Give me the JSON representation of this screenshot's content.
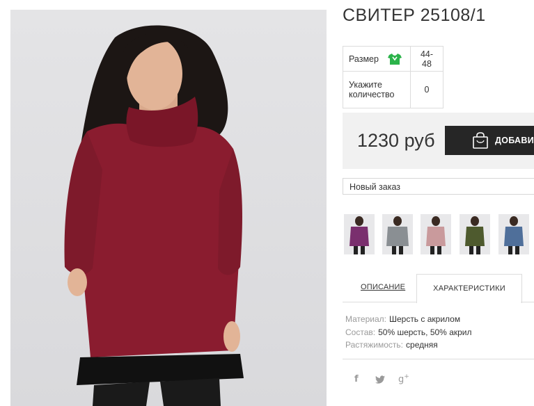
{
  "product": {
    "title": "СВИТЕР 25108/1",
    "options": {
      "size_label": "Размер",
      "size_value": "44-48",
      "qty_label": "Укажите количество",
      "qty_value": "0"
    },
    "price": "1230 руб",
    "add_button_label": "ДОБАВИТЬ",
    "order_select_value": "Новый заказ",
    "thumbnails": [
      {
        "color": "#7a2f6e"
      },
      {
        "color": "#8a8f93"
      },
      {
        "color": "#c99a9c"
      },
      {
        "color": "#4e5a2e"
      },
      {
        "color": "#4f6f9a"
      }
    ]
  },
  "tabs": {
    "description": "ОПИСАНИЕ",
    "characteristics": "ХАРАКТЕРИСТИКИ"
  },
  "specs": [
    {
      "key": "Материал:",
      "value": "Шерсть с акрилом"
    },
    {
      "key": "Состав:",
      "value": "50% шерсть, 50% акрил"
    },
    {
      "key": "Растяжимость:",
      "value": "средняя"
    }
  ],
  "social": {
    "facebook": "f",
    "twitter": "🐦",
    "google": "g+"
  },
  "colors": {
    "sweater": "#8a1c2f",
    "button_bg": "#262626",
    "size_icon": "#2bb34a"
  }
}
